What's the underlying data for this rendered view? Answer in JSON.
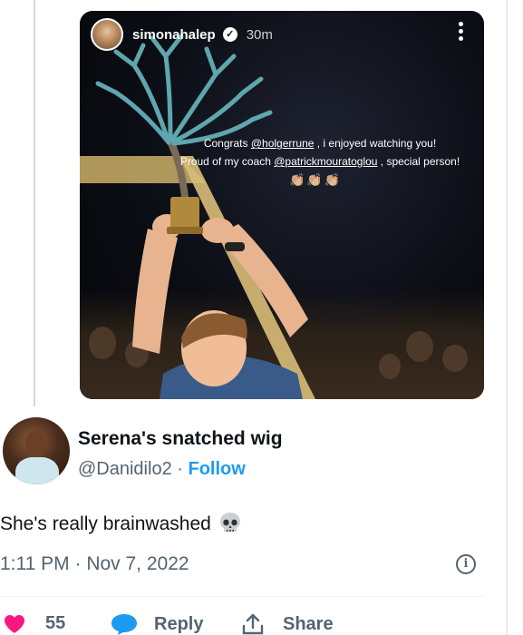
{
  "story": {
    "username": "simonahalep",
    "time": "30m",
    "caption_line1_pre": "Congrats ",
    "caption_line1_mention": "@holgerrune",
    "caption_line1_post": " , i enjoyed watching you!",
    "caption_line2_pre": "Proud of my coach ",
    "caption_line2_mention": "@patrickmouratoglou",
    "caption_line2_post": " , special person!",
    "claps": "👏🏼👏🏼👏🏼"
  },
  "reply": {
    "display_name": "Serena's snatched wig",
    "handle": "@Danidilo2",
    "separator": " · ",
    "follow_label": "Follow",
    "text": "She's really brainwashed",
    "time": "1:11 PM",
    "date": "Nov 7, 2022",
    "meta_separator": " · "
  },
  "actions": {
    "like_count": "55",
    "reply_label": "Reply",
    "share_label": "Share"
  },
  "colors": {
    "accent": "#1d9bf0",
    "like": "#f91880",
    "muted": "#536471"
  }
}
